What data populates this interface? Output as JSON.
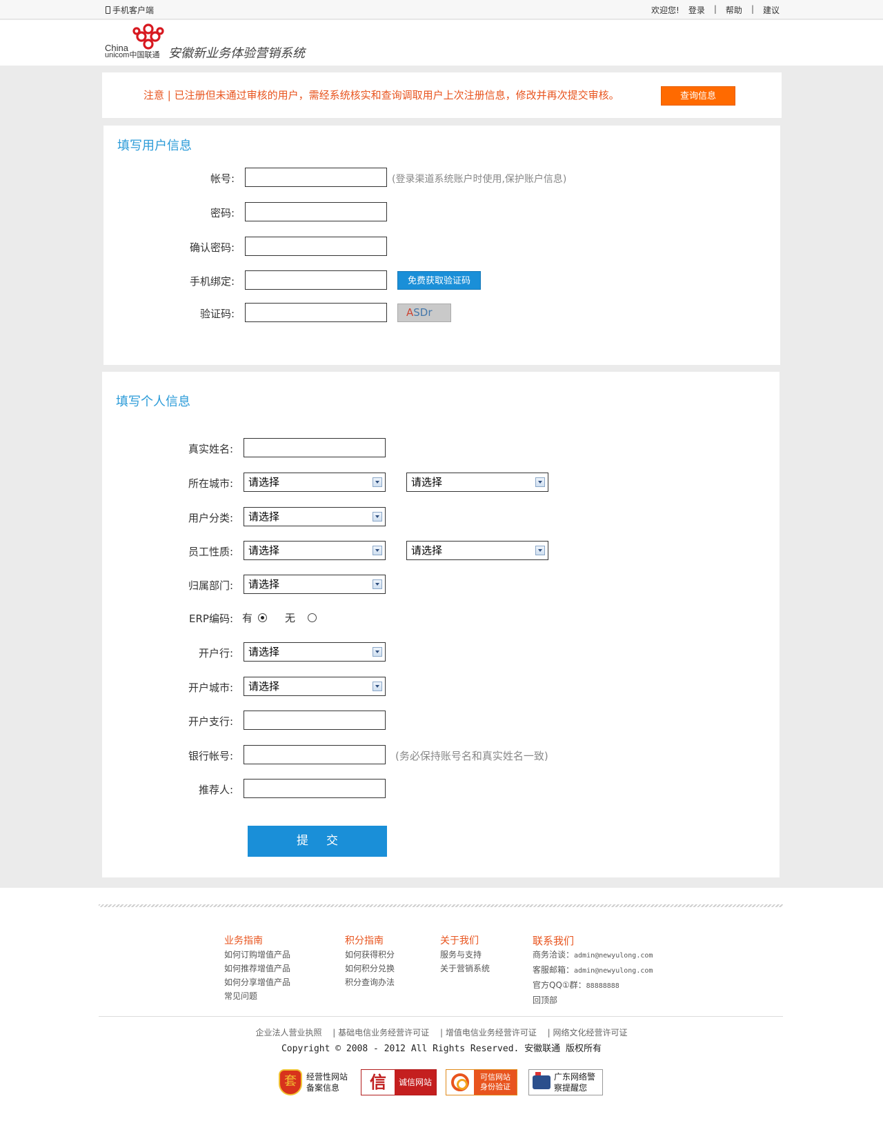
{
  "topbar": {
    "mobile_client": "手机客户端",
    "welcome": "欢迎您!",
    "login": "登录",
    "help": "帮助",
    "suggest": "建议",
    "separator": "|"
  },
  "header": {
    "logo_text_1": "China",
    "logo_text_2": "unicom中国联通",
    "system_title": "安徽新业务体验营销系统"
  },
  "notice": {
    "text": "注意 | 已注册但未通过审核的用户，需经系统核实和查询调取用户上次注册信息，修改并再次提交审核。",
    "query_button": "查询信息"
  },
  "user_info": {
    "title": "填写用户信息",
    "account_label": "帐号:",
    "account_hint": "(登录渠道系统账户时使用,保护账户信息)",
    "password_label": "密码:",
    "confirm_password_label": "确认密码:",
    "phone_label": "手机绑定:",
    "sms_button": "免费获取验证码",
    "captcha_label": "验证码:",
    "captcha_text_1": "A",
    "captcha_text_2": "SDr"
  },
  "personal_info": {
    "title": "填写个人信息",
    "real_name_label": "真实姓名:",
    "city_label": "所在城市:",
    "user_type_label": "用户分类:",
    "employee_label": "员工性质:",
    "department_label": "归属部门:",
    "erp_label": "ERP编码:",
    "erp_yes": "有",
    "erp_no": "无",
    "bank_label": "开户行:",
    "bank_city_label": "开户城市:",
    "bank_branch_label": "开户支行:",
    "bank_account_label": "银行帐号:",
    "bank_account_hint": "(务必保持账号名和真实姓名一致)",
    "referrer_label": "推荐人:",
    "select_placeholder": "请选择",
    "submit_button": "提交"
  },
  "footer": {
    "col1": {
      "title": "业务指南",
      "items": [
        "如何订购增值产品",
        "如何推荐增值产品",
        "如何分享增值产品",
        "常见问题"
      ]
    },
    "col2": {
      "title": "积分指南",
      "items": [
        "如何获得积分",
        "如何积分兑换",
        "积分查询办法"
      ]
    },
    "col3": {
      "title": "关于我们",
      "items": [
        "服务与支持",
        "关于营销系统"
      ]
    },
    "col4": {
      "title": "联系我们",
      "business_label": "商务洽谈：",
      "business_email": "admin@newyulong.com",
      "service_label": "客服邮箱：",
      "service_email": "admin@newyulong.com",
      "qq_label": "官方QQ①群：",
      "qq_number": "88888888",
      "back_to_top": "回顶部"
    },
    "licenses": [
      "企业法人营业执照",
      "| 基础电信业务经营许可证",
      "| 增值电信业务经营许可证",
      "| 网络文化经营许可证"
    ],
    "copyright": "Copyright © 2008 - 2012  All Rights Reserved. 安徽联通 版权所有",
    "badges": {
      "b1_line1": "经营性网站",
      "b1_line2": "备案信息",
      "b1_glyph": "套",
      "b2_glyph": "信",
      "b2_text": "诚信网站",
      "b3_line1": "可信网站",
      "b3_line2": "身份验证",
      "b4_line1": "广东网络警",
      "b4_line2": "察提醒您"
    }
  },
  "colors": {
    "accent_orange": "#ff6a00",
    "accent_blue": "#1a8fd8",
    "title_blue": "#2b9bd8",
    "notice_red": "#e8541e"
  }
}
